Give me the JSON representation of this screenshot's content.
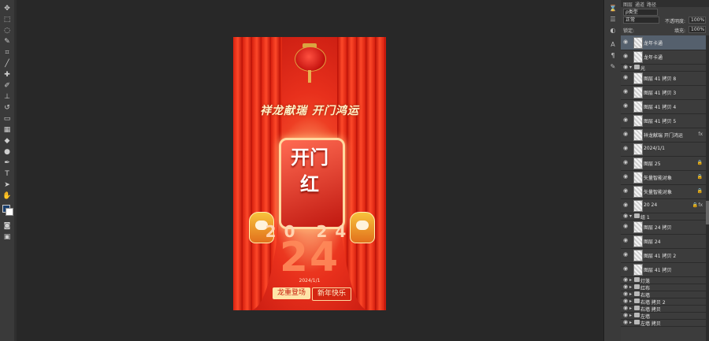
{
  "panel": {
    "tabs": [
      "图层",
      "通道",
      "路径"
    ],
    "filter_label": "ρ类型",
    "blend_mode": "正常",
    "opacity_label": "不透明度:",
    "opacity_value": "100%",
    "lock_label": "锁定:",
    "fill_label": "填充:",
    "fill_value": "100%"
  },
  "layers": [
    {
      "name": "龙年卡通",
      "type": "layer",
      "selected": true
    },
    {
      "name": "龙年卡通",
      "type": "layer"
    },
    {
      "name": "光",
      "type": "group-open"
    },
    {
      "name": "图层 41 拷贝 8",
      "type": "layer"
    },
    {
      "name": "图层 41 拷贝 3",
      "type": "layer"
    },
    {
      "name": "图层 41 拷贝 4",
      "type": "layer"
    },
    {
      "name": "图层 41 拷贝 5",
      "type": "layer"
    },
    {
      "name": "祥龙献瑞 开门鸿运",
      "type": "layer",
      "badge": "fx"
    },
    {
      "name": "2024/1/1",
      "type": "layer"
    },
    {
      "name": "图层 25",
      "type": "layer",
      "badge": "lock"
    },
    {
      "name": "矢量智能对象",
      "type": "layer",
      "badge": "lock"
    },
    {
      "name": "矢量智能对象",
      "type": "layer",
      "badge": "lock"
    },
    {
      "name": "20 24",
      "type": "layer",
      "badge": "lock fx"
    },
    {
      "name": "组 1",
      "type": "group-open"
    },
    {
      "name": "图层 24 拷贝",
      "type": "layer"
    },
    {
      "name": "图层 24",
      "type": "layer"
    },
    {
      "name": "图层 41 拷贝 2",
      "type": "layer"
    },
    {
      "name": "图层 41 拷贝",
      "type": "layer"
    },
    {
      "name": "灯笼",
      "type": "group"
    },
    {
      "name": "红布",
      "type": "group"
    },
    {
      "name": "右墙",
      "type": "group"
    },
    {
      "name": "右墙 拷贝 2",
      "type": "group"
    },
    {
      "name": "右墙 拷贝",
      "type": "group"
    },
    {
      "name": "左墙",
      "type": "group"
    },
    {
      "name": "左墙 拷贝",
      "type": "group"
    }
  ],
  "poster": {
    "slogan": "祥龙献瑞 开门鸿运",
    "door_text": "开门红",
    "year_top": "20 24",
    "year_big": "24",
    "date": "2024/1/1",
    "button1": "龙重登场",
    "button2": "新年快乐"
  }
}
